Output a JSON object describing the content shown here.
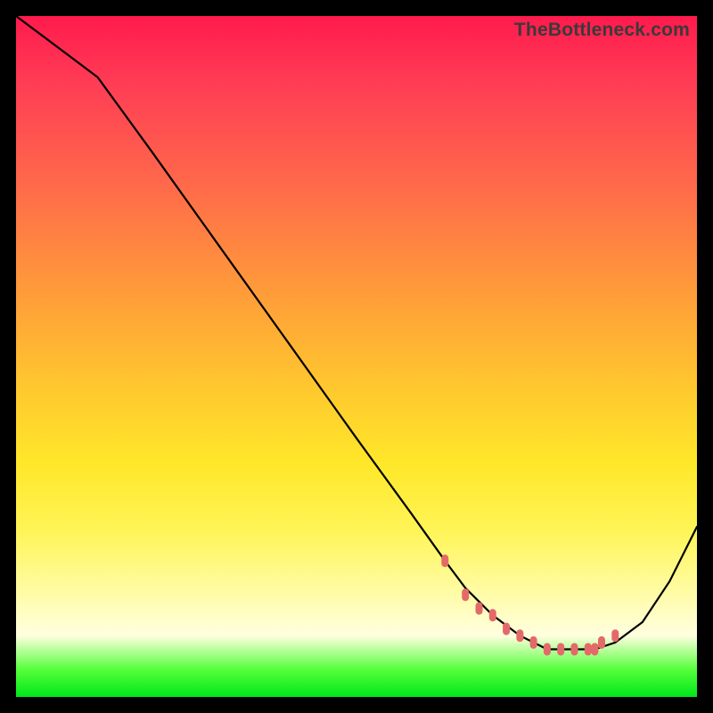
{
  "watermark": {
    "text": "TheBottleneck.com"
  },
  "chart_data": {
    "type": "line",
    "title": "",
    "xlabel": "",
    "ylabel": "",
    "xlim": [
      0,
      100
    ],
    "ylim": [
      0,
      100
    ],
    "grid": false,
    "series": [
      {
        "name": "bottleneck-curve",
        "x": [
          0,
          4,
          8,
          12,
          20,
          30,
          40,
          50,
          58,
          63,
          66,
          70,
          74,
          78,
          82,
          85,
          88,
          92,
          96,
          100
        ],
        "values": [
          100,
          97,
          94,
          91,
          80,
          66,
          52,
          38,
          27,
          20,
          16,
          12,
          9,
          7,
          7,
          7,
          8,
          11,
          17,
          25
        ]
      }
    ],
    "markers": {
      "name": "optimal-range-dots",
      "color": "#e46a6a",
      "x": [
        63,
        66,
        68,
        70,
        72,
        74,
        76,
        78,
        80,
        82,
        84,
        85,
        86,
        88
      ],
      "values": [
        20,
        15,
        13,
        12,
        10,
        9,
        8,
        7,
        7,
        7,
        7,
        7,
        8,
        9
      ]
    },
    "background_gradient": {
      "stops": [
        {
          "pct": 0,
          "color": "#ff1a4d"
        },
        {
          "pct": 40,
          "color": "#ff9a3a"
        },
        {
          "pct": 66,
          "color": "#ffe82a"
        },
        {
          "pct": 91,
          "color": "#ffffe0"
        },
        {
          "pct": 100,
          "color": "#00e61a"
        }
      ]
    }
  }
}
